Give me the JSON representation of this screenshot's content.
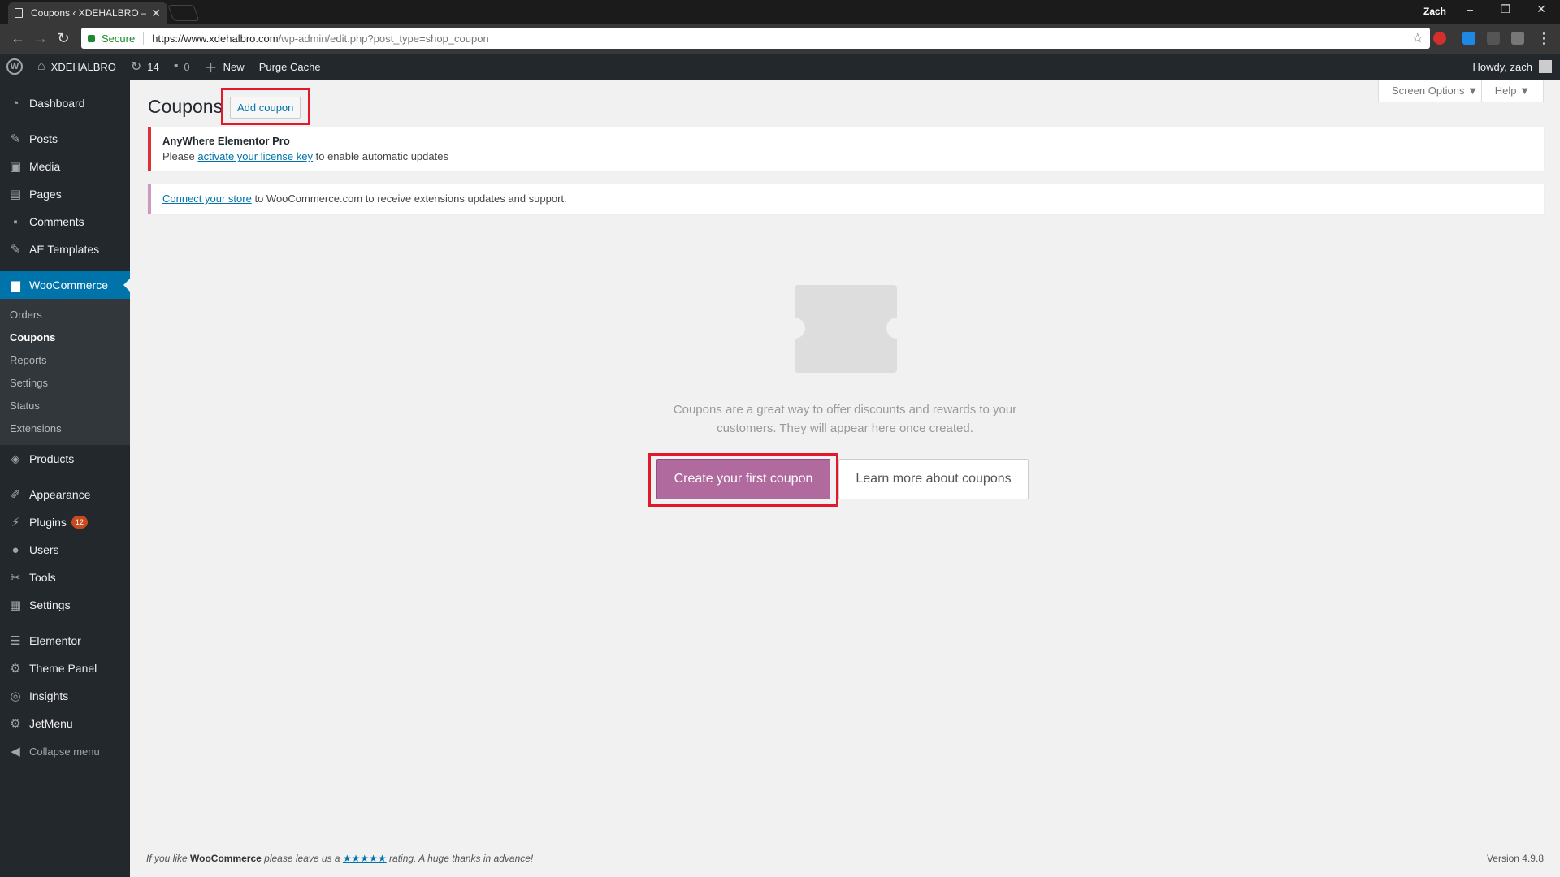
{
  "browser": {
    "tab_title": "Coupons ‹ XDEHALBRO –",
    "window_user": "Zach",
    "secure_label": "Secure",
    "url_host": "https://www.xdehalbro.com",
    "url_path": "/wp-admin/edit.php?post_type=shop_coupon"
  },
  "adminbar": {
    "site_name": "XDEHALBRO",
    "updates_count": "14",
    "comments_count": "0",
    "new_label": "New",
    "purge_label": "Purge Cache",
    "howdy": "Howdy, zach"
  },
  "sidebar": {
    "dashboard": "Dashboard",
    "posts": "Posts",
    "media": "Media",
    "pages": "Pages",
    "comments": "Comments",
    "ae_templates": "AE Templates",
    "woocommerce": "WooCommerce",
    "sub": {
      "orders": "Orders",
      "coupons": "Coupons",
      "reports": "Reports",
      "settings": "Settings",
      "status": "Status",
      "extensions": "Extensions"
    },
    "products": "Products",
    "appearance": "Appearance",
    "plugins": "Plugins",
    "plugins_badge": "12",
    "users": "Users",
    "tools": "Tools",
    "settings": "Settings",
    "elementor": "Elementor",
    "theme_panel": "Theme Panel",
    "insights": "Insights",
    "jetmenu": "JetMenu",
    "collapse": "Collapse menu"
  },
  "header": {
    "screen_options": "Screen Options ▼",
    "help": "Help ▼",
    "title": "Coupons",
    "add_coupon": "Add coupon"
  },
  "notices": {
    "elementor_title": "AnyWhere Elementor Pro",
    "elementor_pre": "Please ",
    "elementor_link": "activate your license key",
    "elementor_post": " to enable automatic updates",
    "connect_link": "Connect your store",
    "connect_post": " to WooCommerce.com to receive extensions updates and support."
  },
  "empty_state": {
    "line1": "Coupons are a great way to offer discounts and rewards to your",
    "line2": "customers. They will appear here once created.",
    "create_button": "Create your first coupon",
    "learn_button": "Learn more about coupons"
  },
  "footer": {
    "pre": "If you like ",
    "brand": "WooCommerce",
    "mid": " please leave us a ",
    "stars": "★★★★★",
    "post": " rating. A huge thanks in advance!",
    "version": "Version 4.9.8"
  },
  "colors": {
    "admin_dark": "#23282d",
    "accent_blue": "#0073aa",
    "woo_purple": "#b16a9e",
    "highlight_red": "#e0192b"
  }
}
